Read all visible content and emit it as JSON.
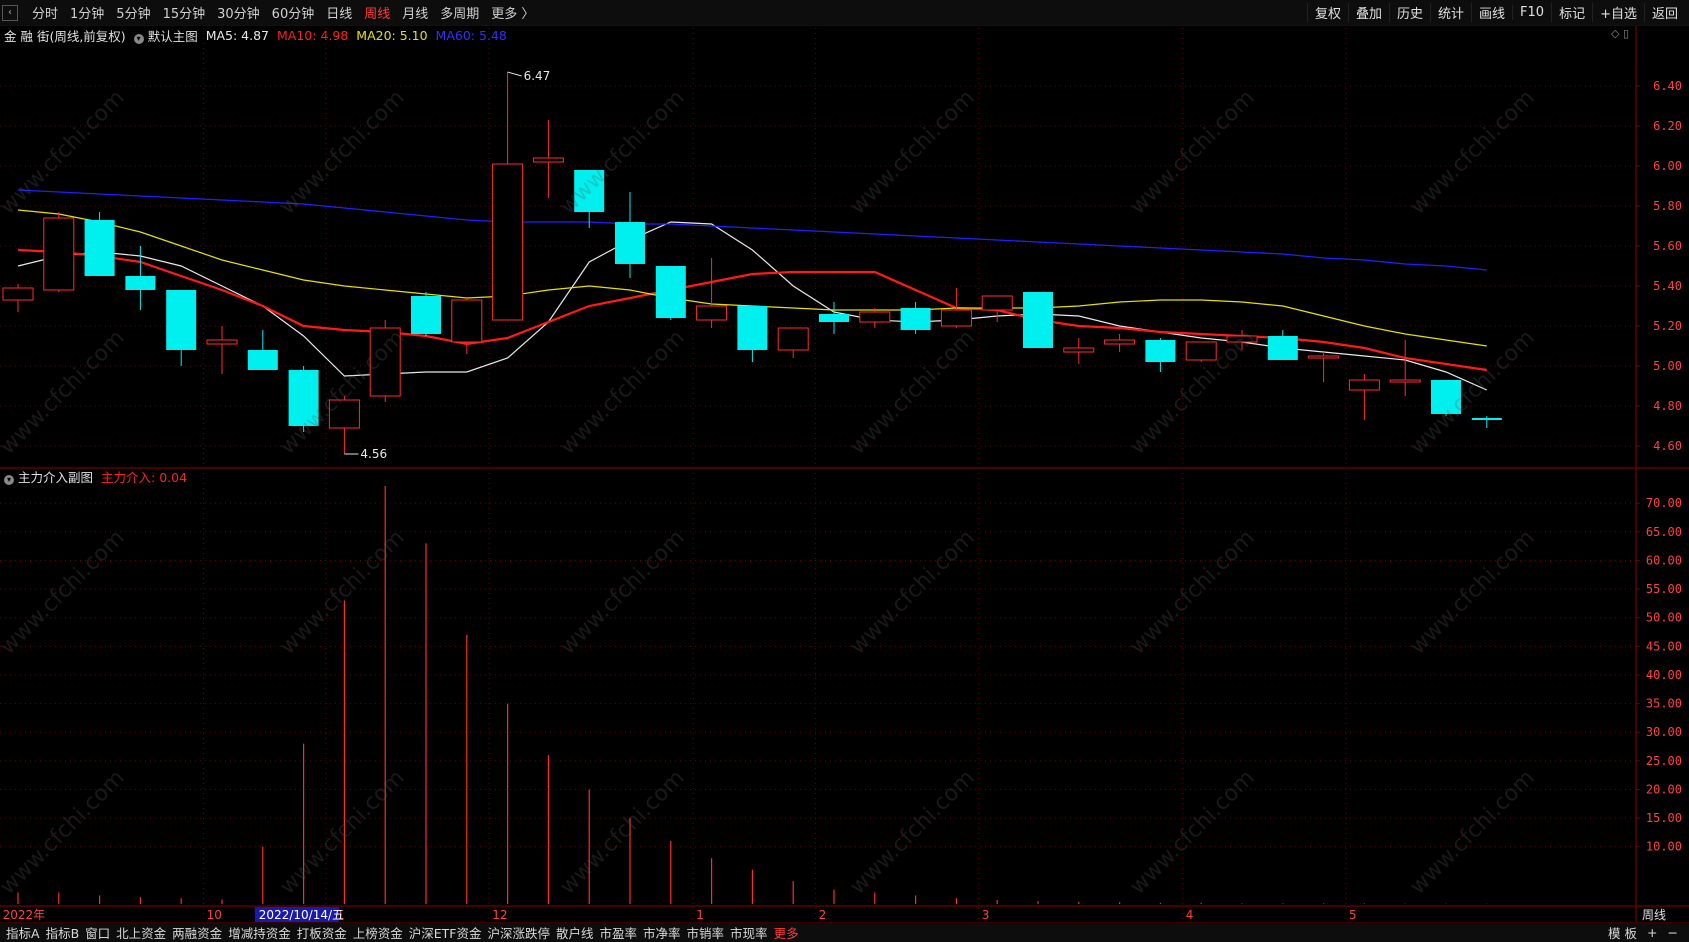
{
  "topbar": {
    "toggle_glyph": "‹",
    "periods": [
      {
        "label": "分时",
        "active": false
      },
      {
        "label": "1分钟",
        "active": false
      },
      {
        "label": "5分钟",
        "active": false
      },
      {
        "label": "15分钟",
        "active": false
      },
      {
        "label": "30分钟",
        "active": false
      },
      {
        "label": "60分钟",
        "active": false
      },
      {
        "label": "日线",
        "active": false
      },
      {
        "label": "周线",
        "active": true
      },
      {
        "label": "月线",
        "active": false
      },
      {
        "label": "多周期",
        "active": false
      },
      {
        "label": "更多 〉",
        "active": false
      }
    ],
    "right_buttons": [
      "复权",
      "叠加",
      "历史",
      "统计",
      "画线",
      "F10",
      "标记",
      "+自选",
      "返回"
    ]
  },
  "main_legend": {
    "stock": "金 融 街(周线,前复权)",
    "template": "默认主图",
    "ma5": "MA5: 4.87",
    "ma10": "MA10: 4.98",
    "ma20": "MA20: 5.10",
    "ma60": "MA60: 5.48"
  },
  "sub_legend": {
    "title": "主力介入副图",
    "value": "主力介入: 0.04"
  },
  "colors": {
    "up": "#ff2a2a",
    "down": "#00f0f0",
    "ma5": "#e8e8e8",
    "ma10": "#ff1a1a",
    "ma20": "#e8e000",
    "ma60": "#2020ff",
    "grid": "#6b0000",
    "axis_text": "#ff4040"
  },
  "chart_data": {
    "type": "candlestick",
    "price_axis": {
      "min": 4.5,
      "max": 6.6,
      "ticks": [
        "6.40",
        "6.20",
        "6.00",
        "5.80",
        "5.60",
        "5.40",
        "5.20",
        "5.00",
        "4.80",
        "4.60"
      ]
    },
    "annotations": {
      "high": "6.47",
      "low": "4.56"
    },
    "candles": [
      {
        "o": 5.33,
        "c": 5.39,
        "h": 5.41,
        "l": 5.27
      },
      {
        "o": 5.38,
        "c": 5.74,
        "h": 5.77,
        "l": 5.37
      },
      {
        "o": 5.73,
        "c": 5.45,
        "h": 5.77,
        "l": 5.45
      },
      {
        "o": 5.45,
        "c": 5.38,
        "h": 5.6,
        "l": 5.28
      },
      {
        "o": 5.38,
        "c": 5.08,
        "h": 5.38,
        "l": 5.0
      },
      {
        "o": 5.11,
        "c": 5.13,
        "h": 5.2,
        "l": 4.96
      },
      {
        "o": 5.08,
        "c": 4.98,
        "h": 5.18,
        "l": 4.98
      },
      {
        "o": 4.98,
        "c": 4.7,
        "h": 5.0,
        "l": 4.67
      },
      {
        "o": 4.69,
        "c": 4.83,
        "h": 4.85,
        "l": 4.56
      },
      {
        "o": 4.85,
        "c": 5.19,
        "h": 5.23,
        "l": 4.82
      },
      {
        "o": 5.35,
        "c": 5.16,
        "h": 5.37,
        "l": 5.15
      },
      {
        "o": 5.12,
        "c": 5.33,
        "h": 5.34,
        "l": 5.06
      },
      {
        "o": 5.23,
        "c": 6.01,
        "h": 6.47,
        "l": 5.23
      },
      {
        "o": 6.02,
        "c": 6.04,
        "h": 6.23,
        "l": 5.84
      },
      {
        "o": 5.98,
        "c": 5.77,
        "h": 5.98,
        "l": 5.69
      },
      {
        "o": 5.72,
        "c": 5.51,
        "h": 5.87,
        "l": 5.44
      },
      {
        "o": 5.5,
        "c": 5.24,
        "h": 5.5,
        "l": 5.23
      },
      {
        "o": 5.23,
        "c": 5.3,
        "h": 5.54,
        "l": 5.19
      },
      {
        "o": 5.3,
        "c": 5.08,
        "h": 5.3,
        "l": 5.02
      },
      {
        "o": 5.08,
        "c": 5.19,
        "h": 5.19,
        "l": 5.04
      },
      {
        "o": 5.26,
        "c": 5.22,
        "h": 5.32,
        "l": 5.16
      },
      {
        "o": 5.22,
        "c": 5.27,
        "h": 5.29,
        "l": 5.19
      },
      {
        "o": 5.29,
        "c": 5.18,
        "h": 5.32,
        "l": 5.16
      },
      {
        "o": 5.2,
        "c": 5.28,
        "h": 5.39,
        "l": 5.19
      },
      {
        "o": 5.28,
        "c": 5.35,
        "h": 5.35,
        "l": 5.22
      },
      {
        "o": 5.37,
        "c": 5.09,
        "h": 5.37,
        "l": 5.09
      },
      {
        "o": 5.07,
        "c": 5.09,
        "h": 5.14,
        "l": 5.01
      },
      {
        "o": 5.11,
        "c": 5.13,
        "h": 5.16,
        "l": 5.07
      },
      {
        "o": 5.13,
        "c": 5.02,
        "h": 5.14,
        "l": 4.97
      },
      {
        "o": 5.03,
        "c": 5.12,
        "h": 5.12,
        "l": 5.02
      },
      {
        "o": 5.12,
        "c": 5.15,
        "h": 5.18,
        "l": 5.08
      },
      {
        "o": 5.15,
        "c": 5.03,
        "h": 5.18,
        "l": 5.03
      },
      {
        "o": 5.05,
        "c": 5.05,
        "h": 5.07,
        "l": 4.92
      },
      {
        "o": 4.88,
        "c": 4.93,
        "h": 4.96,
        "l": 4.73
      },
      {
        "o": 4.93,
        "c": 4.93,
        "h": 5.13,
        "l": 4.85
      },
      {
        "o": 4.93,
        "c": 4.76,
        "h": 4.93,
        "l": 4.75
      },
      {
        "o": 4.74,
        "c": 4.73,
        "h": 4.75,
        "l": 4.69
      }
    ],
    "ma_series": [
      {
        "name": "MA5",
        "values": [
          5.5,
          5.55,
          5.57,
          5.55,
          5.5,
          5.4,
          5.3,
          5.15,
          4.95,
          4.96,
          4.97,
          4.97,
          5.04,
          5.22,
          5.52,
          5.63,
          5.72,
          5.71,
          5.58,
          5.4,
          5.27,
          5.23,
          5.22,
          5.23,
          5.25,
          5.26,
          5.25,
          5.2,
          5.17,
          5.14,
          5.12,
          5.09,
          5.07,
          5.05,
          5.03,
          4.97,
          4.88
        ]
      },
      {
        "name": "MA10",
        "values": [
          5.58,
          5.57,
          5.55,
          5.52,
          5.45,
          5.38,
          5.3,
          5.2,
          5.18,
          5.17,
          5.15,
          5.11,
          5.14,
          5.22,
          5.3,
          5.34,
          5.38,
          5.42,
          5.46,
          5.47,
          5.47,
          5.47,
          5.38,
          5.29,
          5.28,
          5.23,
          5.2,
          5.19,
          5.17,
          5.16,
          5.15,
          5.14,
          5.12,
          5.09,
          5.04,
          5.01,
          4.98
        ]
      },
      {
        "name": "MA20",
        "values": [
          5.78,
          5.76,
          5.72,
          5.67,
          5.6,
          5.53,
          5.48,
          5.43,
          5.4,
          5.38,
          5.36,
          5.34,
          5.35,
          5.38,
          5.4,
          5.38,
          5.34,
          5.31,
          5.3,
          5.29,
          5.28,
          5.28,
          5.28,
          5.29,
          5.29,
          5.29,
          5.3,
          5.32,
          5.33,
          5.33,
          5.32,
          5.3,
          5.25,
          5.2,
          5.16,
          5.13,
          5.1
        ]
      },
      {
        "name": "MA60",
        "values": [
          5.88,
          5.87,
          5.86,
          5.85,
          5.84,
          5.83,
          5.82,
          5.81,
          5.79,
          5.77,
          5.75,
          5.73,
          5.72,
          5.72,
          5.72,
          5.71,
          5.71,
          5.7,
          5.69,
          5.68,
          5.67,
          5.66,
          5.65,
          5.64,
          5.63,
          5.62,
          5.61,
          5.6,
          5.59,
          5.58,
          5.57,
          5.56,
          5.54,
          5.53,
          5.51,
          5.5,
          5.48
        ]
      }
    ],
    "sub_axis": {
      "min": 0,
      "max": 73,
      "ticks": [
        "70.00",
        "65.00",
        "60.00",
        "55.00",
        "50.00",
        "45.00",
        "40.00",
        "35.00",
        "30.00",
        "25.00",
        "20.00",
        "15.00",
        "10.00"
      ]
    },
    "sub_values": [
      2,
      2,
      1.5,
      1.2,
      1,
      0.8,
      10,
      28,
      53,
      73,
      63,
      47,
      35,
      26,
      20,
      15,
      11,
      8,
      6,
      4,
      2.5,
      2,
      1.5,
      1,
      0.7,
      0.5,
      0.4,
      0.3,
      0.2,
      0.2,
      0.1,
      0.1,
      0.1,
      0.1,
      0.05,
      0.05,
      0.04
    ],
    "x_labels": [
      {
        "i": 0,
        "text": "2022年"
      },
      {
        "i": 5,
        "text": "10"
      },
      {
        "i": 8,
        "text": "11"
      },
      {
        "i": 12,
        "text": "12"
      },
      {
        "i": 17,
        "text": "1"
      },
      {
        "i": 20,
        "text": "2"
      },
      {
        "i": 24,
        "text": "3"
      },
      {
        "i": 29,
        "text": "4"
      },
      {
        "i": 33,
        "text": "5"
      }
    ],
    "cursor_date": "2022/10/14/五",
    "period_label": "周线"
  },
  "bottombar": {
    "items": [
      {
        "label": "指标A",
        "active": false
      },
      {
        "label": "指标B",
        "active": false
      },
      {
        "label": "窗口",
        "active": false
      },
      {
        "label": "北上资金",
        "active": false
      },
      {
        "label": "两融资金",
        "active": false
      },
      {
        "label": "增减持资金",
        "active": false
      },
      {
        "label": "打板资金",
        "active": false
      },
      {
        "label": "上榜资金",
        "active": false
      },
      {
        "label": "沪深ETF资金",
        "active": false
      },
      {
        "label": "沪深涨跌停",
        "active": false
      },
      {
        "label": "散户线",
        "active": false
      },
      {
        "label": "市盈率",
        "active": false
      },
      {
        "label": "市净率",
        "active": false
      },
      {
        "label": "市销率",
        "active": false
      },
      {
        "label": "市现率",
        "active": false
      },
      {
        "label": "更多",
        "active": true
      }
    ],
    "right": [
      "模 板",
      "+",
      "−"
    ]
  },
  "watermark": "www.cfchi.com"
}
